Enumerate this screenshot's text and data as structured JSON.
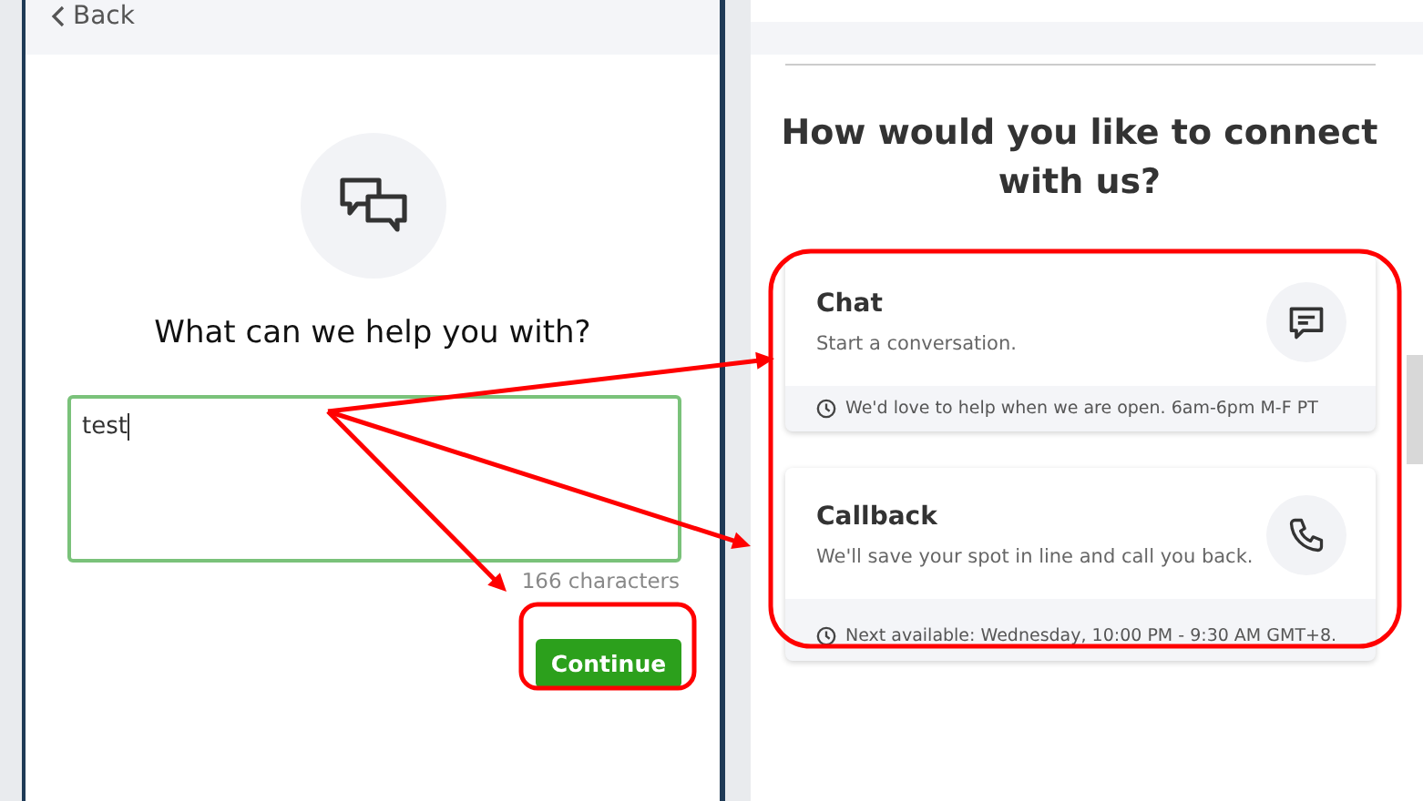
{
  "left_panel": {
    "back": "Back",
    "question": "What can we help you with?",
    "message": {
      "value": "test",
      "focused": true
    },
    "char_count": "166 characters",
    "continue_button": "Continue"
  },
  "right_panel": {
    "heading": "How would you like to connect with us?",
    "options": [
      {
        "kind": "chat",
        "title": "Chat",
        "description": "Start a conversation.",
        "note": "We'd love to help when we are open. 6am-6pm M-F PT"
      },
      {
        "kind": "callback",
        "title": "Callback",
        "description": "We'll save your spot in line and call you back.",
        "note": "Next available: Wednesday, 10:00 PM - 9:30 AM GMT+8."
      }
    ]
  }
}
